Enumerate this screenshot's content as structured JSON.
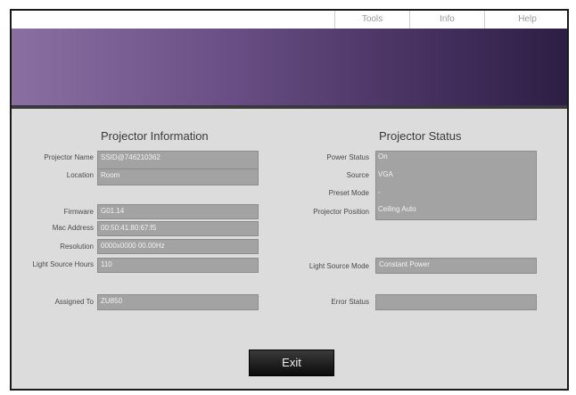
{
  "nav": {
    "items": [
      "Tools",
      "Info",
      "Help"
    ]
  },
  "info": {
    "title": "Projector Information",
    "projector_name": {
      "label": "Projector Name",
      "value": "SSID@746210362"
    },
    "location": {
      "label": "Location",
      "value": "Room"
    },
    "firmware": {
      "label": "Firmware",
      "value": "G01.14"
    },
    "mac_address": {
      "label": "Mac Address",
      "value": "00:50:41:80:67:f5"
    },
    "resolution": {
      "label": "Resolution",
      "value": "0000x0000 00.00Hz"
    },
    "light_source_hours": {
      "label": "Light Source Hours",
      "value": "110"
    },
    "assigned_to": {
      "label": "Assigned To",
      "value": "ZU850"
    }
  },
  "status": {
    "title": "Projector Status",
    "power_status": {
      "label": "Power Status",
      "value": "On"
    },
    "source": {
      "label": "Source",
      "value": "VGA"
    },
    "preset_mode": {
      "label": "Preset Mode",
      "value": "-"
    },
    "projector_position": {
      "label": "Projector Position",
      "value": "Ceiling Auto"
    },
    "light_source_mode": {
      "label": "Light Source Mode",
      "value": "Constant Power"
    },
    "error_status": {
      "label": "Error Status",
      "value": ""
    }
  },
  "exit_label": "Exit"
}
